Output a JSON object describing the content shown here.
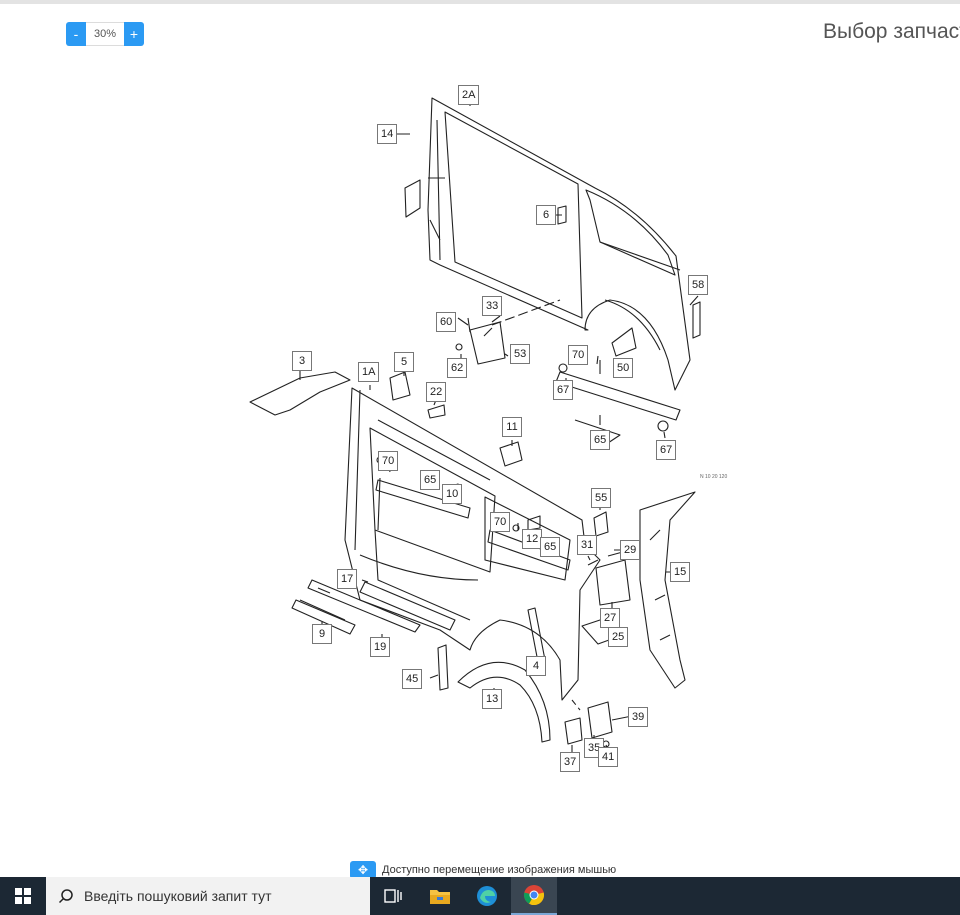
{
  "toolbar": {
    "zoom_minus": "-",
    "zoom_value": "30%",
    "zoom_plus": "+"
  },
  "page": {
    "title": "Выбор запчаст"
  },
  "diagram": {
    "callouts": [
      "2A",
      "14",
      "6",
      "58",
      "33",
      "60",
      "62",
      "53",
      "70",
      "50",
      "67",
      "65",
      "67",
      "3",
      "1A",
      "5",
      "22",
      "11",
      "70",
      "65",
      "10",
      "55",
      "70",
      "12",
      "65",
      "31",
      "29",
      "15",
      "17",
      "9",
      "19",
      "27",
      "25",
      "4",
      "45",
      "13",
      "39",
      "35",
      "37",
      "41"
    ],
    "stamp": "N 10 20 120"
  },
  "hint": {
    "text": "Доступно перемещение изображения мышью"
  },
  "taskbar": {
    "search_placeholder": "Введіть пошуковий запит тут",
    "icons": [
      "windows-start-icon",
      "search-icon",
      "task-view-icon",
      "file-explorer-icon",
      "edge-icon",
      "chrome-icon"
    ]
  }
}
